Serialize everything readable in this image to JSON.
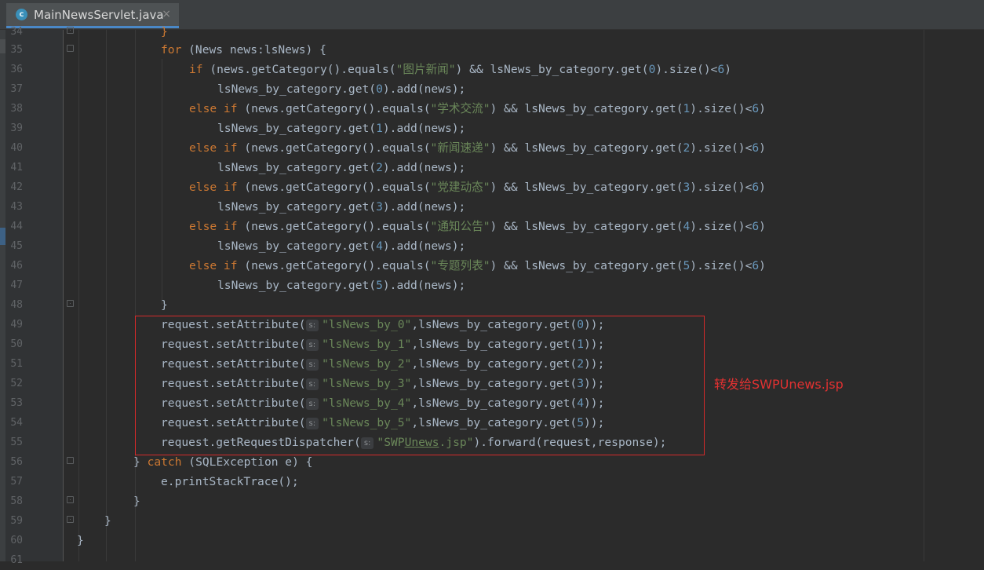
{
  "tab": {
    "icon_letter": "c",
    "title": "MainNewsServlet.java",
    "close": "×"
  },
  "colors": {
    "keyword": "#cc7832",
    "string": "#6a8759",
    "number": "#6897bb",
    "plain": "#a9b7c6",
    "annotation": "#e23131",
    "highlight_box": "#d42a2a"
  },
  "lines": [
    {
      "n": "34"
    },
    {
      "n": "35"
    },
    {
      "n": "36"
    },
    {
      "n": "37"
    },
    {
      "n": "38"
    },
    {
      "n": "39"
    },
    {
      "n": "40"
    },
    {
      "n": "41"
    },
    {
      "n": "42"
    },
    {
      "n": "43"
    },
    {
      "n": "44"
    },
    {
      "n": "45"
    },
    {
      "n": "46"
    },
    {
      "n": "47"
    },
    {
      "n": "48"
    },
    {
      "n": "49"
    },
    {
      "n": "50"
    },
    {
      "n": "51"
    },
    {
      "n": "52"
    },
    {
      "n": "53"
    },
    {
      "n": "54"
    },
    {
      "n": "55"
    },
    {
      "n": "56"
    },
    {
      "n": "57"
    },
    {
      "n": "58"
    },
    {
      "n": "59"
    },
    {
      "n": "60"
    },
    {
      "n": "61"
    }
  ],
  "code": {
    "l35": {
      "kw": "for",
      "text": " (News news:lsNews) {"
    },
    "l36": {
      "kw": "if",
      "a": " (news.getCategory().equals(",
      "s": "\"图片新闻\"",
      "b": ") && lsNews_by_category.get(",
      "n1": "0",
      "c": ").size()<",
      "n2": "6",
      "d": ")"
    },
    "l37": {
      "a": "lsNews_by_category.get(",
      "n": "0",
      "b": ").add(news);"
    },
    "l38": {
      "kw": "else if",
      "a": " (news.getCategory().equals(",
      "s": "\"学术交流\"",
      "b": ") && lsNews_by_category.get(",
      "n1": "1",
      "c": ").size()<",
      "n2": "6",
      "d": ")"
    },
    "l39": {
      "a": "lsNews_by_category.get(",
      "n": "1",
      "b": ").add(news);"
    },
    "l40": {
      "kw": "else if",
      "a": " (news.getCategory().equals(",
      "s": "\"新闻速递\"",
      "b": ") && lsNews_by_category.get(",
      "n1": "2",
      "c": ").size()<",
      "n2": "6",
      "d": ")"
    },
    "l41": {
      "a": "lsNews_by_category.get(",
      "n": "2",
      "b": ").add(news);"
    },
    "l42": {
      "kw": "else if",
      "a": " (news.getCategory().equals(",
      "s": "\"党建动态\"",
      "b": ") && lsNews_by_category.get(",
      "n1": "3",
      "c": ").size()<",
      "n2": "6",
      "d": ")"
    },
    "l43": {
      "a": "lsNews_by_category.get(",
      "n": "3",
      "b": ").add(news);"
    },
    "l44": {
      "kw": "else if",
      "a": " (news.getCategory().equals(",
      "s": "\"通知公告\"",
      "b": ") && lsNews_by_category.get(",
      "n1": "4",
      "c": ").size()<",
      "n2": "6",
      "d": ")"
    },
    "l45": {
      "a": "lsNews_by_category.get(",
      "n": "4",
      "b": ").add(news);"
    },
    "l46": {
      "kw": "else if",
      "a": " (news.getCategory().equals(",
      "s": "\"专题列表\"",
      "b": ") && lsNews_by_category.get(",
      "n1": "5",
      "c": ").size()<",
      "n2": "6",
      "d": ")"
    },
    "l47": {
      "a": "lsNews_by_category.get(",
      "n": "5",
      "b": ").add(news);"
    },
    "l48": {
      "text": "}"
    },
    "hint": "s:",
    "l49": {
      "a": "request.setAttribute(",
      "s": "\"lsNews_by_0\"",
      "b": ",lsNews_by_category.get(",
      "n": "0",
      "c": "));"
    },
    "l50": {
      "a": "request.setAttribute(",
      "s": "\"lsNews_by_1\"",
      "b": ",lsNews_by_category.get(",
      "n": "1",
      "c": "));"
    },
    "l51": {
      "a": "request.setAttribute(",
      "s": "\"lsNews_by_2\"",
      "b": ",lsNews_by_category.get(",
      "n": "2",
      "c": "));"
    },
    "l52": {
      "a": "request.setAttribute(",
      "s": "\"lsNews_by_3\"",
      "b": ",lsNews_by_category.get(",
      "n": "3",
      "c": "));"
    },
    "l53": {
      "a": "request.setAttribute(",
      "s": "\"lsNews_by_4\"",
      "b": ",lsNews_by_category.get(",
      "n": "4",
      "c": "));"
    },
    "l54": {
      "a": "request.setAttribute(",
      "s": "\"lsNews_by_5\"",
      "b": ",lsNews_by_category.get(",
      "n": "5",
      "c": "));"
    },
    "l55": {
      "a": "request.getRequestDispatcher(",
      "s1": "\"SWP",
      "s2": "Unews",
      "s3": ".jsp\"",
      "b": ").forward(request,response);"
    },
    "l56": {
      "a": "} ",
      "kw": "catch",
      "b": " (SQLException e) {"
    },
    "l57": {
      "text": "e.printStackTrace();"
    },
    "l58": {
      "text": "}"
    },
    "l59": {
      "text": "}"
    },
    "l60": {
      "text": "}"
    }
  },
  "annotation": "转发给SWPUnews.jsp"
}
